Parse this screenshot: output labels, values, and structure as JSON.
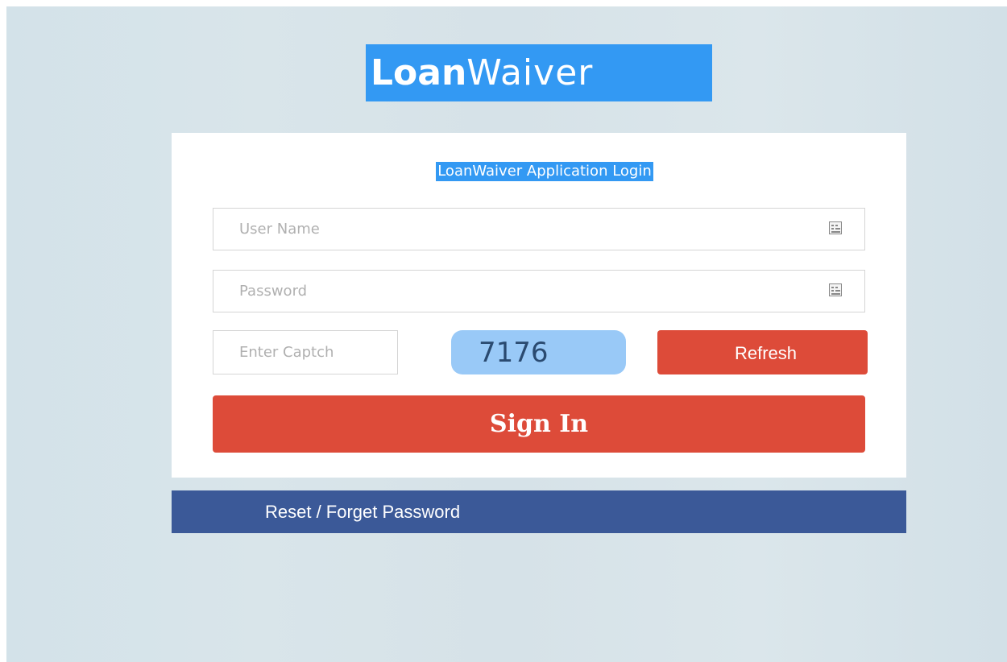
{
  "logo": {
    "bold_part": "Loan",
    "light_part": "Waiver"
  },
  "card": {
    "title": "LoanWaiver Application Login"
  },
  "fields": {
    "username": {
      "placeholder": "User Name",
      "value": ""
    },
    "password": {
      "placeholder": "Password",
      "value": ""
    },
    "captcha": {
      "placeholder": "Enter Captch",
      "value": ""
    },
    "field_icon": "keyboard-icon"
  },
  "captcha_code": "7176",
  "buttons": {
    "refresh": "Refresh",
    "sign_in": "Sign In",
    "reset": "Reset / Forget Password"
  },
  "colors": {
    "accent_blue": "#3399f3",
    "button_red": "#dd4b39",
    "reset_bar": "#3b5998",
    "captcha_bg": "#99c9f7"
  }
}
